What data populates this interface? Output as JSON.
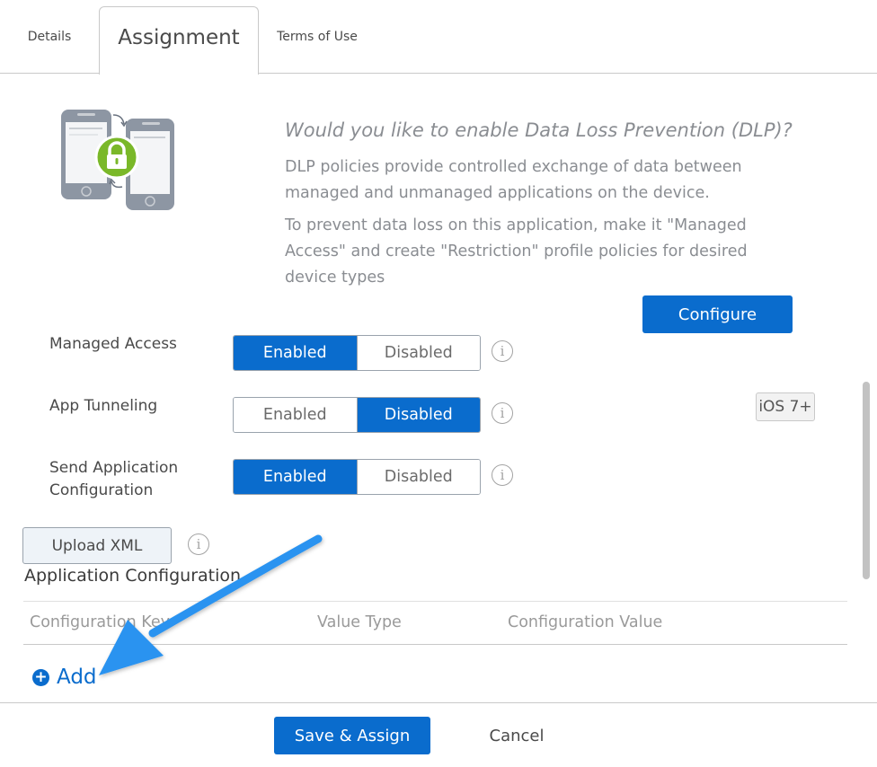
{
  "tabs": [
    {
      "label": "Details"
    },
    {
      "label": "Assignment"
    },
    {
      "label": "Terms of Use"
    }
  ],
  "dlp": {
    "title": "Would you like to enable Data Loss Prevention (DLP)?",
    "paragraph1": "DLP policies provide controlled exchange of data between managed and unmanaged applications on the device.",
    "paragraph2": "To prevent data loss on this application, make it \"Managed Access\" and create \"Restriction\" profile policies for desired device types",
    "configure_label": "Configure"
  },
  "settings": {
    "managed_access": {
      "label": "Managed Access",
      "enabled": "Enabled",
      "disabled": "Disabled",
      "selected": "Enabled"
    },
    "app_tunneling": {
      "label": "App Tunneling",
      "enabled": "Enabled",
      "disabled": "Disabled",
      "selected": "Disabled",
      "badge": "iOS 7+"
    },
    "send_app_config": {
      "label": "Send Application Configuration",
      "enabled": "Enabled",
      "disabled": "Disabled",
      "selected": "Enabled"
    }
  },
  "upload_label": "Upload XML",
  "app_config": {
    "title": "Application Configuration",
    "columns": [
      "Configuration Key",
      "Value Type",
      "Configuration Value"
    ],
    "add_label": "Add"
  },
  "footer": {
    "save_label": "Save & Assign",
    "cancel_label": "Cancel"
  },
  "colors": {
    "accent": "#0a6ccd",
    "lock_green": "#7ab829",
    "annotation_arrow": "#2b93f0"
  },
  "icons": {
    "info": "info-circle-icon",
    "add": "plus-circle-icon",
    "dlp_illustration": "phones-lock-icon"
  }
}
